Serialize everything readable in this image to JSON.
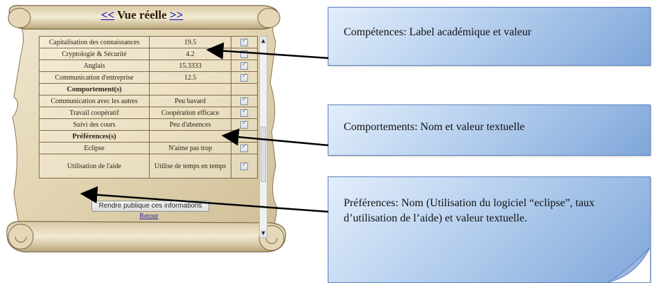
{
  "header": {
    "prev_link": "<<",
    "title": "Vue réelle",
    "next_link": ">>"
  },
  "table": {
    "rows": [
      {
        "type": "row",
        "label": "Capitalisation des connaissances",
        "value": "19.5",
        "checked": true
      },
      {
        "type": "row",
        "label": "Cryptologie & Sécurité",
        "value": "4.2",
        "checked": true
      },
      {
        "type": "row",
        "label": "Anglais",
        "value": "15.3333",
        "checked": true
      },
      {
        "type": "row",
        "label": "Communication d'entreprise",
        "value": "12.5",
        "checked": true
      },
      {
        "type": "section",
        "label": "Comportement(s)"
      },
      {
        "type": "row",
        "label": "Communication avec les autres",
        "value": "Peu bavard",
        "checked": true
      },
      {
        "type": "row",
        "label": "Travail coopératif",
        "value": "Coopération efficace",
        "checked": true
      },
      {
        "type": "row",
        "label": "Suivi des cours",
        "value": "Peu d'absences",
        "checked": true
      },
      {
        "type": "section",
        "label": "Préférences(s)"
      },
      {
        "type": "row",
        "label": "Eclipse",
        "value": "N'aime pas trop",
        "checked": true
      },
      {
        "type": "row",
        "label": "Utilisation de l'aide",
        "value": "Utilise de temps en temps",
        "checked": true
      }
    ]
  },
  "actions": {
    "publish_label": "Rendre publique ces informations",
    "back_label": "Retour"
  },
  "callouts": {
    "competences": "Compétences: Label académique et valeur",
    "comportements": "Comportements: Nom et valeur textuelle",
    "preferences": "Préférences: Nom (Utilisation du logiciel “eclipse”, taux d’utilisation de l’aide) et valeur textuelle."
  },
  "colors": {
    "parchment": "#e8dcc0",
    "callout_blue": "#9dbbe4",
    "link_blue": "#0000cc"
  }
}
